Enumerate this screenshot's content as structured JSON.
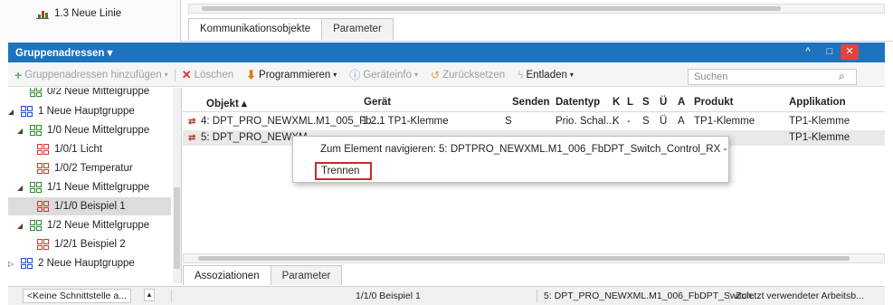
{
  "top": {
    "tree_item": "1.3 Neue Linie",
    "tabs": [
      "Kommunikationsobjekte",
      "Parameter"
    ]
  },
  "panel": {
    "title": "Gruppenadressen ▾",
    "close_glyph": "✕",
    "min_glyph": "^",
    "max_glyph": "□"
  },
  "toolbar": {
    "add": "Gruppenadressen hinzufügen",
    "delete": "Löschen",
    "program": "Programmieren",
    "deviceinfo": "Geräteinfo",
    "reset": "Zurücksetzen",
    "unload": "Entladen",
    "search_placeholder": "Suchen"
  },
  "tree": [
    {
      "label": "0/2 Neue Mittelgruppe",
      "level": 2,
      "exp": "",
      "color": "#2e8b2e"
    },
    {
      "label": "1 Neue Hauptgruppe",
      "level": 1,
      "exp": "◢",
      "color": "#1a4fd0"
    },
    {
      "label": "1/0 Neue Mittelgruppe",
      "level": 2,
      "exp": "◢",
      "color": "#2e8b2e"
    },
    {
      "label": "1/0/1 Licht",
      "level": 3,
      "exp": "",
      "color": "#d9342b"
    },
    {
      "label": "1/0/2 Temperatur",
      "level": 3,
      "exp": "",
      "color": "#d9342b"
    },
    {
      "label": "1/1 Neue Mittelgruppe",
      "level": 2,
      "exp": "◢",
      "color": "#2e8b2e"
    },
    {
      "label": "1/1/0 Beispiel 1",
      "level": 3,
      "exp": "",
      "color": "#d9342b",
      "selected": true
    },
    {
      "label": "1/2 Neue Mittelgruppe",
      "level": 2,
      "exp": "◢",
      "color": "#2e8b2e"
    },
    {
      "label": "1/2/1 Beispiel 2",
      "level": 3,
      "exp": "",
      "color": "#d9342b"
    },
    {
      "label": "2 Neue Hauptgruppe",
      "level": 1,
      "exp": "▷",
      "color": "#1a4fd0"
    }
  ],
  "table": {
    "headers": [
      "Objekt ▴",
      "Gerät",
      "Senden",
      "Datentyp",
      "K",
      "L",
      "S",
      "Ü",
      "A",
      "Produkt",
      "Applikation"
    ],
    "rows": [
      [
        "4: DPT_PRO_NEWXML.M1_005_Fb...",
        "1.2.1 TP1-Klemme",
        "S",
        "Prio. Schal...",
        "K",
        "-",
        "S",
        "Ü",
        "A",
        "TP1-Klemme",
        "TP1-Klemme"
      ],
      [
        "5: DPT_PRO_NEWXM",
        "",
        "",
        "",
        "",
        "",
        "",
        "",
        "",
        "",
        "TP1-Klemme"
      ]
    ]
  },
  "popup": {
    "navigate": "Zum Element navigieren: 5: DPTPRO_NEWXML.M1_006_FbDPT_Switch_Control_RX -",
    "disconnect": "Trennen"
  },
  "bottom_tabs": [
    "Assoziationen",
    "Parameter"
  ],
  "status": {
    "interface": "<Keine Schnittstelle a...",
    "selection": "1/1/0 Beispiel 1",
    "object": "5: DPT_PRO_NEWXML.M1_006_FbDPT_Switch...",
    "workspace": "Zuletzt verwendeter Arbeitsb..."
  }
}
